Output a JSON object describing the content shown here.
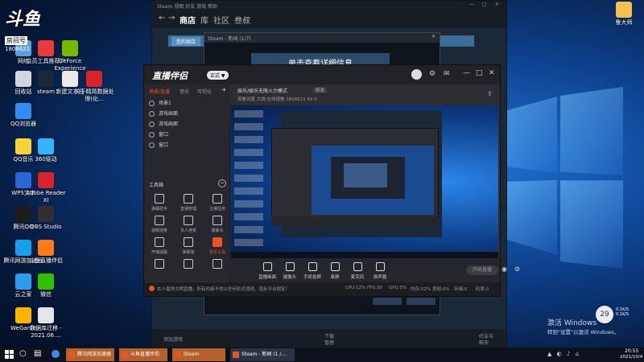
{
  "desktop": {
    "icons": [
      {
        "label": "网络",
        "color": "#5aa0e0"
      },
      {
        "label": "回收站",
        "color": "#cfd6de"
      },
      {
        "label": "QQ浏览器",
        "color": "#2f8ef0"
      },
      {
        "label": "QQ音乐",
        "color": "#f5d43a"
      },
      {
        "label": "WPS文字",
        "color": "#2a66d6"
      },
      {
        "label": "腾讯QQ",
        "color": "#1d1d1d"
      },
      {
        "label": "腾讯网游加速器",
        "color": "#16a0e8"
      },
      {
        "label": "云之家",
        "color": "#2d9be8"
      },
      {
        "label": "WeGame",
        "color": "#ffb200"
      },
      {
        "label": "会员工具推荐户",
        "color": "#e83b3b"
      },
      {
        "label": "steam",
        "color": "#1b2838"
      },
      {
        "label": "360驱动",
        "color": "#35b3ff"
      },
      {
        "label": "Adobe Reader XI",
        "color": "#d8232a"
      },
      {
        "label": "OBS Studio",
        "color": "#302e31"
      },
      {
        "label": "斗鱼直播伴侣",
        "color": "#ff7a1a"
      },
      {
        "label": "微信",
        "color": "#2dc100"
      },
      {
        "label": "数据库迁移 - 2021.06....",
        "color": "#e5e5e5"
      },
      {
        "label": "GeForce Experience",
        "color": "#76b900"
      },
      {
        "label": "新建文本档",
        "color": "#eaeaea"
      },
      {
        "label": "关于精简数据处理(化...",
        "color": "#d8232a"
      }
    ],
    "room_label": "房间号",
    "room_number": "1808621",
    "top_right_icon_label": "鲁大师",
    "watermark_title": "激活 Windows",
    "watermark_sub": "转到\"设置\"以激活 Windows。",
    "widget_value": "29",
    "widget_sub1": "0.1K/S",
    "widget_sub2": "0.1K/S"
  },
  "steam": {
    "menu": "Steam  视图  好友  游戏  帮助",
    "nav_back": "←",
    "nav_fwd": "→",
    "nav_store": "商店",
    "nav_library": "库",
    "nav_community": "社区",
    "nav_user": "叁叔",
    "store_btn": "您的商店",
    "news_title": "Steam - 新闻 (1/7)",
    "news_banner": "单击查看详细信息",
    "add_game": "添加游戏",
    "downloads": "下载",
    "downloads_sub": "管理",
    "friends": "好友与",
    "friends_sub": "聊天"
  },
  "app": {
    "logo": "直播伴侣",
    "version": "正式 ▼",
    "tabs": [
      "场景/直播",
      "音乐",
      "可视化"
    ],
    "scenes": [
      "场景1",
      "游戏画面",
      "游戏画面",
      "窗口",
      "窗口"
    ],
    "toolbox_title": "工具箱",
    "tools": [
      "弹幕助手",
      "直播管理",
      "主播任务",
      "视频连麦",
      "多人连麦",
      "摄像头",
      "开播提醒",
      "弹幕墙",
      "更多工具",
      "",
      "",
      ""
    ],
    "stream_title": "娱乐/娱乐无限火力模式",
    "stream_tag": "修改",
    "stream_meta": "观看设置   大炮   在线观看   1808621   45   0",
    "controls": [
      "直播画面",
      "摄像头",
      "手机投屏",
      "录屏",
      "麦克风",
      "扬声器"
    ],
    "start_btn": "开始直播",
    "status_text": "本人倡导文明直播，所有内容不得以任何形式违规，违反平台规定！",
    "status_right": [
      "CPU:12%",
      "FPS:30",
      "GPU:5%",
      "内存:52%",
      "丢帧:0%",
      "存储:0",
      "码率:0"
    ]
  },
  "taskbar": {
    "apps": [
      "腾讯网游加速器",
      "斗鱼直播伴侣",
      "Steam",
      "Steam - 新闻 (1 /..."
    ],
    "time": "20:55",
    "date": "2021/10/4"
  },
  "colors": {
    "accent": "#e9542c",
    "steam_bg": "#1b2838",
    "app_bg": "#2b2d33"
  }
}
